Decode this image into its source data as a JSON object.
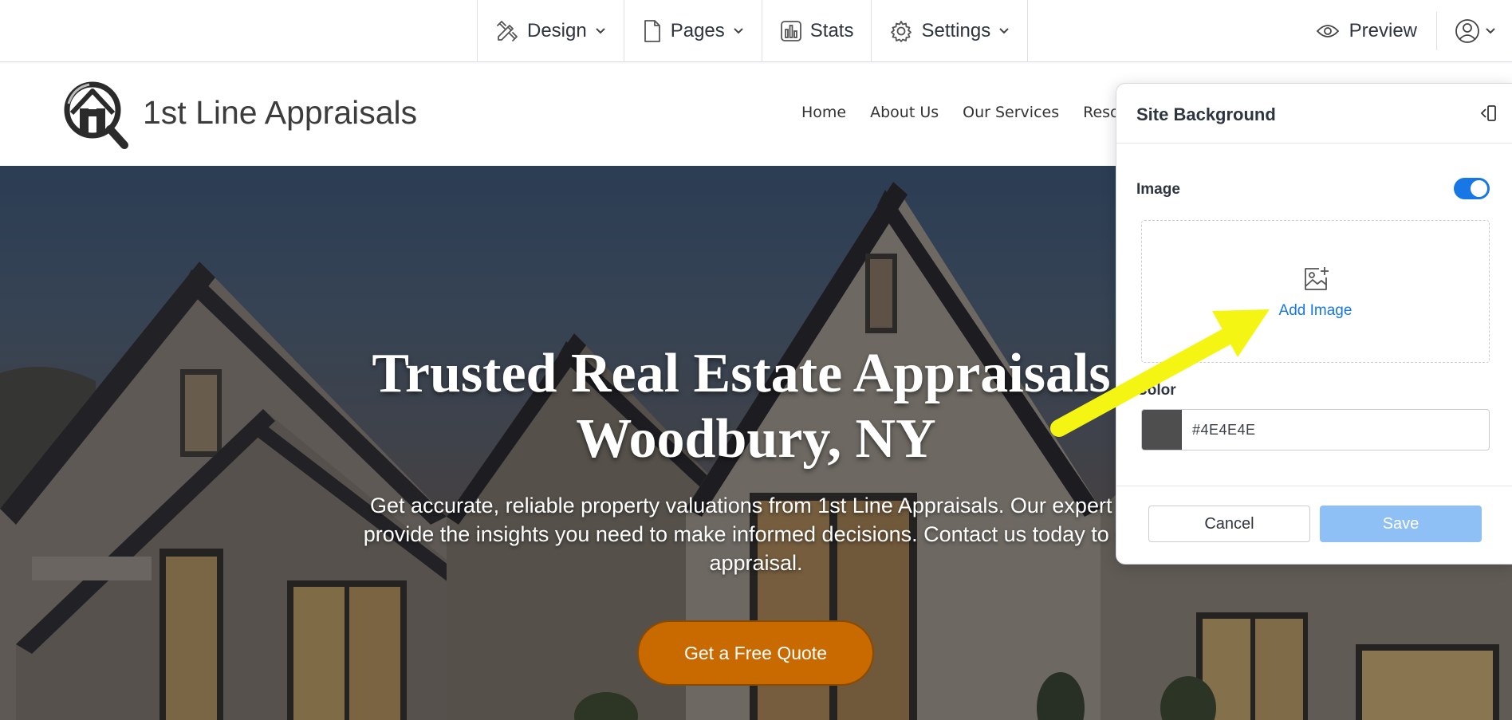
{
  "toolbar": {
    "design": "Design",
    "pages": "Pages",
    "stats": "Stats",
    "settings": "Settings",
    "preview": "Preview"
  },
  "site": {
    "title": "1st Line Appraisals",
    "nav": [
      "Home",
      "About Us",
      "Our Services",
      "Resour"
    ]
  },
  "hero": {
    "title_line1": "Trusted Real Estate Appraisals i",
    "title_line2": "Woodbury, NY",
    "subtitle_line1": "Get accurate, reliable property valuations from 1st Line Appraisals. Our expert ap",
    "subtitle_line2": "provide the insights you need to make informed decisions. Contact us today to sch",
    "subtitle_line3": "appraisal.",
    "cta": "Get a Free Quote"
  },
  "panel": {
    "title": "Site Background",
    "image_label": "Image",
    "image_enabled": true,
    "add_image": "Add Image",
    "color_label": "Color",
    "color_value": "#4E4E4E",
    "cancel": "Cancel",
    "save": "Save"
  },
  "colors": {
    "accent": "#1677e5",
    "cta": "#c96a00",
    "annotation_arrow": "#f5f514",
    "swatch": "#4E4E4E"
  }
}
